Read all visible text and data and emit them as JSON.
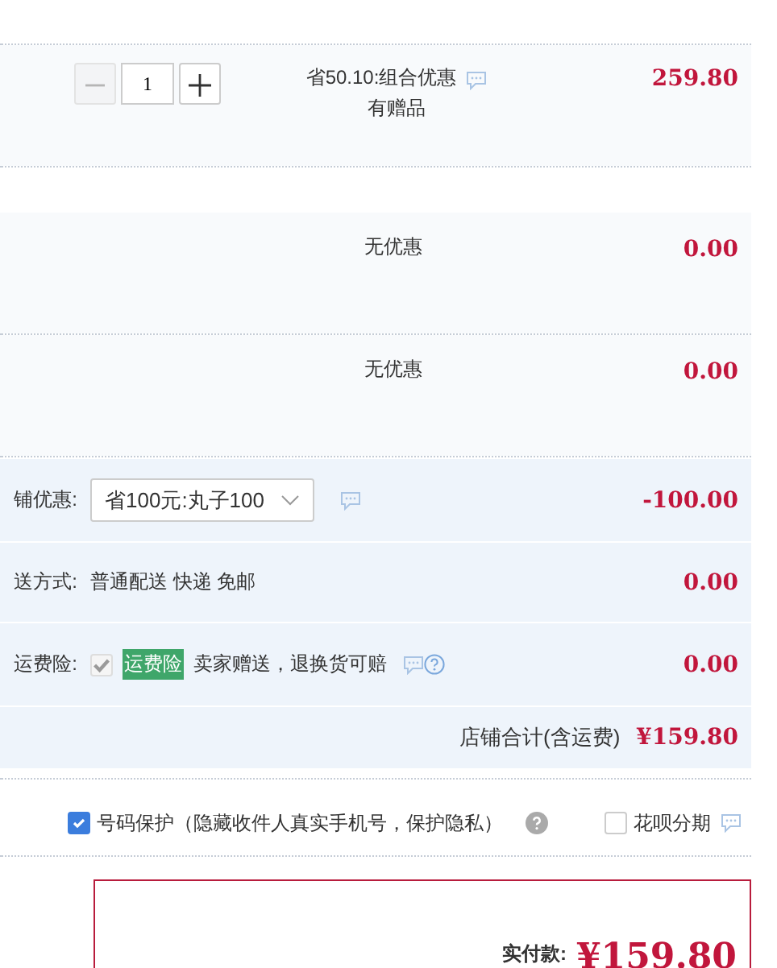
{
  "item": {
    "quantity": "1",
    "decrement_disabled": true,
    "promo": "省50.10:组合优惠",
    "gift": "有赠品",
    "price": "259.80"
  },
  "discount_rows": [
    {
      "text": "无优惠",
      "amount": "0.00"
    },
    {
      "text": "无优惠",
      "amount": "0.00"
    }
  ],
  "store": {
    "coupon": {
      "label": "铺优惠:",
      "value": "省100元:丸子100",
      "amount": "-100.00"
    },
    "shipping": {
      "label": "送方式:",
      "value": "普通配送 快递 免邮",
      "amount": "0.00"
    },
    "insurance": {
      "label": "运费险:",
      "checked": true,
      "disabled": true,
      "tag": "运费险",
      "text": "卖家赠送，退换货可赔",
      "amount": "0.00"
    },
    "total": {
      "label": "店铺合计(含运费)",
      "amount": "¥159.80"
    }
  },
  "options": [
    {
      "kind": "privacy",
      "checked": true,
      "label": "号码保护（隐藏收件人真实手机号，保护隐私）"
    },
    {
      "kind": "installment",
      "checked": false,
      "label": "花呗分期"
    }
  ],
  "payment": {
    "label": "实付款:",
    "amount": "¥159.80"
  }
}
